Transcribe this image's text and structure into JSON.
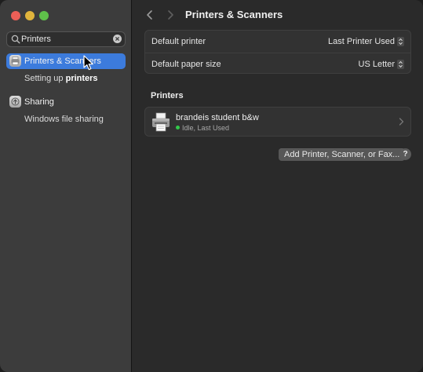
{
  "window": {
    "title": "Printers & Scanners"
  },
  "sidebar": {
    "search": {
      "value": "Printers",
      "placeholder": "Search"
    },
    "items": [
      {
        "label_part1": "Printers",
        "label_part2": " & Scanners",
        "icon": "printer-icon",
        "selected": true,
        "sub": [
          {
            "text_plain": "Setting up ",
            "text_bold": "printers"
          }
        ]
      },
      {
        "label": "Sharing",
        "icon": "sharing-icon",
        "selected": false,
        "sub": [
          {
            "text": "Windows file sharing"
          }
        ]
      }
    ]
  },
  "main": {
    "prefs": [
      {
        "label": "Default printer",
        "value": "Last Printer Used"
      },
      {
        "label": "Default paper size",
        "value": "US Letter"
      }
    ],
    "printers_header": "Printers",
    "printers": [
      {
        "name": "brandeis student b&w",
        "status": "Idle, Last Used",
        "status_color": "#32c94b"
      }
    ],
    "add_button": "Add Printer, Scanner, or Fax...",
    "help_label": "?"
  },
  "colors": {
    "accent": "#3c7bdc",
    "sidebar_bg": "#3c3c3c",
    "content_bg": "#2a2a2a"
  }
}
